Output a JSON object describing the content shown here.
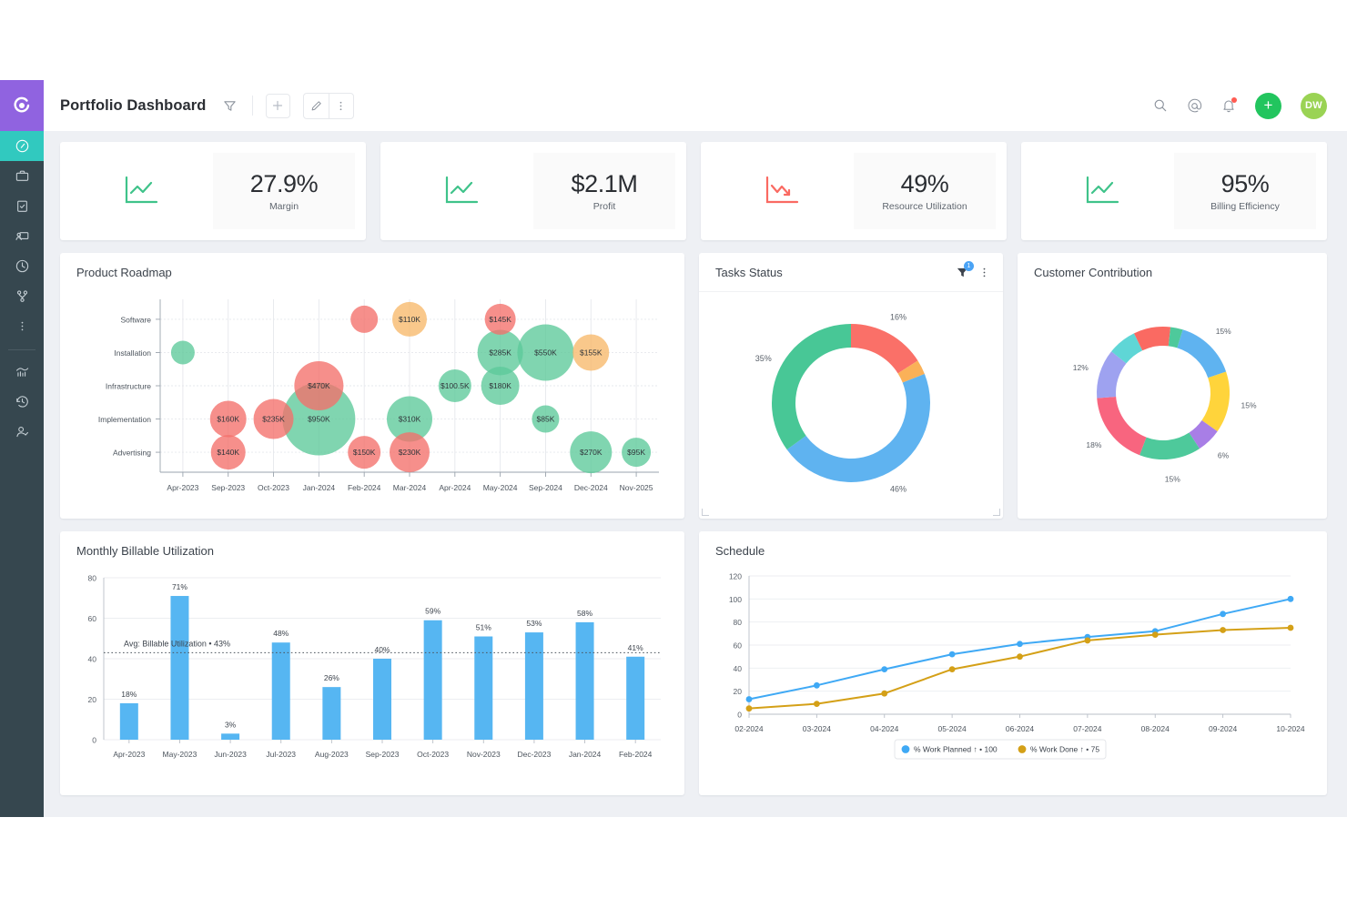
{
  "header": {
    "title": "Portfolio Dashboard",
    "filter_icon": "funnel-icon",
    "add_label": "+",
    "edit_icon": "pencil-icon",
    "more_icon": "kebab-icon",
    "search_icon": "search-icon",
    "mention_icon": "at-icon",
    "notification_icon": "bell-icon",
    "create_label": "+",
    "avatar_initials": "DW"
  },
  "sidebar": {
    "logo": "company-logo",
    "items": [
      {
        "name": "dashboard",
        "icon": "gauge-icon",
        "active": true
      },
      {
        "name": "projects",
        "icon": "briefcase-icon",
        "active": false
      },
      {
        "name": "tasks",
        "icon": "clipboard-check-icon",
        "active": false
      },
      {
        "name": "presentations",
        "icon": "presentation-icon",
        "active": false
      },
      {
        "name": "timesheets",
        "icon": "clock-icon",
        "active": false
      },
      {
        "name": "workflow",
        "icon": "branch-icon",
        "active": false
      },
      {
        "name": "more",
        "icon": "kebab-icon",
        "active": false
      }
    ],
    "items_bottom": [
      {
        "name": "analytics",
        "icon": "analytics-icon",
        "active": false
      },
      {
        "name": "history",
        "icon": "history-icon",
        "active": false
      },
      {
        "name": "user-approval",
        "icon": "user-check-icon",
        "active": false
      }
    ]
  },
  "kpis": [
    {
      "value": "27.9%",
      "label": "Margin",
      "icon": "trend-up-icon",
      "color": "#3fc38a"
    },
    {
      "value": "$2.1M",
      "label": "Profit",
      "icon": "trend-up-icon",
      "color": "#3fc38a"
    },
    {
      "value": "49%",
      "label": "Resource Utilization",
      "icon": "trend-down-icon",
      "color": "#fa6a62"
    },
    {
      "value": "95%",
      "label": "Billing Efficiency",
      "icon": "trend-up-icon",
      "color": "#3fc38a"
    }
  ],
  "cards": {
    "roadmap_title": "Product Roadmap",
    "tasks_title": "Tasks Status",
    "tasks_filter_badge": "1",
    "customer_title": "Customer Contribution",
    "billable_title": "Monthly Billable Utilization",
    "schedule_title": "Schedule"
  },
  "chart_data": [
    {
      "id": "product-roadmap",
      "type": "scatter",
      "title": "Product Roadmap",
      "xlabel": "",
      "ylabel": "",
      "x_categories": [
        "Apr-2023",
        "Sep-2023",
        "Oct-2023",
        "Jan-2024",
        "Feb-2024",
        "Mar-2024",
        "Apr-2024",
        "May-2024",
        "Sep-2024",
        "Dec-2024",
        "Nov-2025"
      ],
      "y_categories": [
        "Advertising",
        "Implementation",
        "Infrastructure",
        "Installation",
        "Software"
      ],
      "grid": true,
      "colors": {
        "green": "#5cc99a",
        "red": "#f4706a",
        "orange": "#f7b96a"
      },
      "points": [
        {
          "x": "Apr-2023",
          "y": "Installation",
          "label": "",
          "size": 13,
          "color": "green"
        },
        {
          "x": "Sep-2023",
          "y": "Implementation",
          "label": "$160K",
          "size": 20,
          "color": "red"
        },
        {
          "x": "Sep-2023",
          "y": "Advertising",
          "label": "$140K",
          "size": 19,
          "color": "red"
        },
        {
          "x": "Oct-2023",
          "y": "Implementation",
          "label": "$235K",
          "size": 22,
          "color": "red"
        },
        {
          "x": "Jan-2024",
          "y": "Infrastructure",
          "label": "$470K",
          "size": 27,
          "color": "red"
        },
        {
          "x": "Jan-2024",
          "y": "Implementation",
          "label": "$950K",
          "size": 40,
          "color": "green"
        },
        {
          "x": "Feb-2024",
          "y": "Software",
          "label": "",
          "size": 15,
          "color": "red"
        },
        {
          "x": "Feb-2024",
          "y": "Advertising",
          "label": "$150K",
          "size": 18,
          "color": "red"
        },
        {
          "x": "Mar-2024",
          "y": "Software",
          "label": "$110K",
          "size": 19,
          "color": "orange"
        },
        {
          "x": "Mar-2024",
          "y": "Implementation",
          "label": "$310K",
          "size": 25,
          "color": "green"
        },
        {
          "x": "Mar-2024",
          "y": "Advertising",
          "label": "$230K",
          "size": 22,
          "color": "red"
        },
        {
          "x": "Apr-2024",
          "y": "Infrastructure",
          "label": "$100.5K",
          "size": 18,
          "color": "green"
        },
        {
          "x": "May-2024",
          "y": "Software",
          "label": "$145K",
          "size": 17,
          "color": "red"
        },
        {
          "x": "May-2024",
          "y": "Installation",
          "label": "$285K",
          "size": 25,
          "color": "green"
        },
        {
          "x": "May-2024",
          "y": "Infrastructure",
          "label": "$180K",
          "size": 21,
          "color": "green"
        },
        {
          "x": "Sep-2024",
          "y": "Installation",
          "label": "$550K",
          "size": 31,
          "color": "green"
        },
        {
          "x": "Sep-2024",
          "y": "Implementation",
          "label": "$85K",
          "size": 15,
          "color": "green"
        },
        {
          "x": "Dec-2024",
          "y": "Installation",
          "label": "$155K",
          "size": 20,
          "color": "orange"
        },
        {
          "x": "Dec-2024",
          "y": "Advertising",
          "label": "$270K",
          "size": 23,
          "color": "green"
        },
        {
          "x": "Nov-2025",
          "y": "Advertising",
          "label": "$95K",
          "size": 16,
          "color": "green"
        }
      ]
    },
    {
      "id": "tasks-status",
      "type": "pie",
      "title": "Tasks Status",
      "labels": [
        "16%",
        "46%",
        "35%"
      ],
      "values": [
        16,
        3,
        46,
        35
      ],
      "value_labels": [
        "16%",
        "",
        "46%",
        "35%"
      ],
      "colors": [
        "#fa7068",
        "#fab158",
        "#5fb3f0",
        "#48c796"
      ],
      "donut": true
    },
    {
      "id": "customer-contribution",
      "type": "pie",
      "title": "Customer Contribution",
      "values": [
        15,
        15,
        6,
        15,
        18,
        12,
        7,
        9,
        3
      ],
      "value_labels": [
        "15%",
        "15%",
        "6%",
        "15%",
        "18%",
        "12%",
        "",
        "",
        ""
      ],
      "colors": [
        "#5fb3f0",
        "#ffd43b",
        "#a87ee6",
        "#4ec99b",
        "#f8657f",
        "#9ea2f0",
        "#5fd6d6",
        "#fa6a62",
        "#4ec99b"
      ],
      "donut": true
    },
    {
      "id": "monthly-billable-utilization",
      "type": "bar",
      "title": "Monthly Billable Utilization",
      "categories": [
        "Apr-2023",
        "May-2023",
        "Jun-2023",
        "Jul-2023",
        "Aug-2023",
        "Sep-2023",
        "Oct-2023",
        "Nov-2023",
        "Dec-2023",
        "Jan-2024",
        "Feb-2024"
      ],
      "values": [
        18,
        71,
        3,
        48,
        26,
        40,
        59,
        51,
        53,
        58,
        41
      ],
      "value_labels": [
        "18%",
        "71%",
        "3%",
        "48%",
        "26%",
        "40%",
        "59%",
        "51%",
        "53%",
        "58%",
        "41%"
      ],
      "ylim": [
        0,
        80
      ],
      "yticks": [
        0,
        20,
        40,
        60,
        80
      ],
      "bar_color": "#56b6f2",
      "avg_line": {
        "value": 43,
        "label": "Avg: Billable Utilization • 43%"
      }
    },
    {
      "id": "schedule",
      "type": "line",
      "title": "Schedule",
      "x": [
        "02-2024",
        "03-2024",
        "04-2024",
        "05-2024",
        "06-2024",
        "07-2024",
        "08-2024",
        "09-2024",
        "10-2024"
      ],
      "ylim": [
        0,
        120
      ],
      "yticks": [
        0,
        20,
        40,
        60,
        80,
        100,
        120
      ],
      "legend_position": "bottom",
      "series": [
        {
          "name": "% Work Planned ↑ • 100",
          "color": "#3fa9f5",
          "values": [
            13,
            25,
            39,
            52,
            61,
            67,
            72,
            87,
            100
          ]
        },
        {
          "name": "% Work Done ↑ • 75",
          "color": "#d4a017",
          "values": [
            5,
            9,
            18,
            39,
            50,
            64,
            69,
            73,
            75
          ]
        }
      ]
    }
  ]
}
